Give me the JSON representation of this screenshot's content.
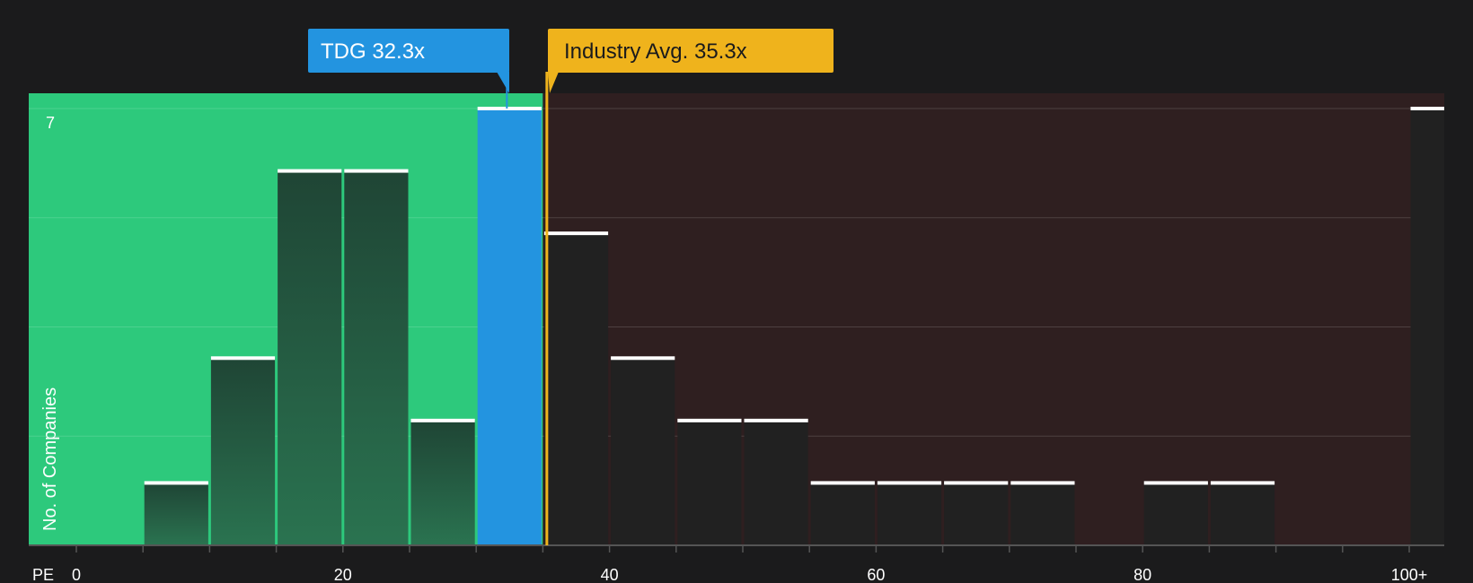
{
  "chart_data": {
    "type": "bar",
    "x_label": "PE",
    "y_label": "No. of Companies",
    "y_max_label": "7",
    "ylim": [
      0,
      7
    ],
    "bin_width": 5,
    "x_ticks": [
      "0",
      "20",
      "40",
      "60",
      "80",
      "100+"
    ],
    "x_tick_values": [
      0,
      20,
      40,
      60,
      80,
      100
    ],
    "bins": [
      {
        "start": 5,
        "count": 1,
        "group": "below"
      },
      {
        "start": 10,
        "count": 3,
        "group": "below"
      },
      {
        "start": 15,
        "count": 6,
        "group": "below"
      },
      {
        "start": 20,
        "count": 6,
        "group": "below"
      },
      {
        "start": 25,
        "count": 2,
        "group": "below"
      },
      {
        "start": 30,
        "count": 7,
        "group": "company"
      },
      {
        "start": 35,
        "count": 5,
        "group": "above"
      },
      {
        "start": 40,
        "count": 3,
        "group": "above"
      },
      {
        "start": 45,
        "count": 2,
        "group": "above"
      },
      {
        "start": 50,
        "count": 2,
        "group": "above"
      },
      {
        "start": 55,
        "count": 1,
        "group": "above"
      },
      {
        "start": 60,
        "count": 1,
        "group": "above"
      },
      {
        "start": 65,
        "count": 1,
        "group": "above"
      },
      {
        "start": 70,
        "count": 1,
        "group": "above"
      },
      {
        "start": 80,
        "count": 1,
        "group": "above"
      },
      {
        "start": 85,
        "count": 1,
        "group": "above"
      },
      {
        "start": 100,
        "count": 7,
        "group": "overflow"
      }
    ],
    "company": {
      "label": "TDG 32.3x",
      "value": 32.3,
      "color": "#2394e0"
    },
    "industry": {
      "label": "Industry Avg. 35.3x",
      "value": 35.3,
      "color": "#efb31c"
    },
    "colors": {
      "below_zone": "#2dc97c",
      "above_zone": "#2f1f20",
      "bar_below": "#23493a",
      "bar_above": "#212121",
      "company_bar": "#2394e0",
      "bar_cap": "#ffffff"
    }
  }
}
